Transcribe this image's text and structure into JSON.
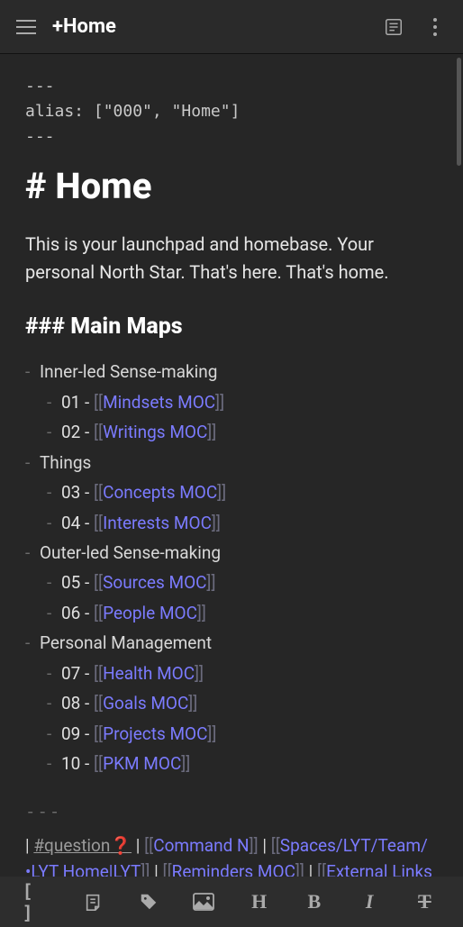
{
  "header": {
    "title": "+Home"
  },
  "frontmatter": {
    "open": "---",
    "line": "alias: [\"000\", \"Home\"]",
    "close": "---"
  },
  "h1": "# Home",
  "intro": "This is your launchpad and homebase. Your personal North Star. That's here. That's home.",
  "h3": "### Main Maps",
  "sections": [
    {
      "label": "Inner-led Sense-making",
      "items": [
        {
          "num": "01",
          "link": "Mindsets MOC"
        },
        {
          "num": "02",
          "link": "Writings MOC"
        }
      ]
    },
    {
      "label": "Things",
      "items": [
        {
          "num": "03",
          "link": "Concepts MOC"
        },
        {
          "num": "04",
          "link": "Interests MOC"
        }
      ]
    },
    {
      "label": "Outer-led Sense-making",
      "items": [
        {
          "num": "05",
          "link": "Sources MOC"
        },
        {
          "num": "06",
          "link": "People MOC"
        }
      ]
    },
    {
      "label": "Personal Management",
      "items": [
        {
          "num": "07",
          "link": "Health MOC"
        },
        {
          "num": "08",
          "link": "Goals MOC"
        },
        {
          "num": "09",
          "link": "Projects MOC"
        },
        {
          "num": "10",
          "link": "PKM MOC"
        }
      ]
    }
  ],
  "hr": "---",
  "footer": {
    "tag": "#question",
    "q": "❓",
    "link1": "Command N",
    "link2": "Spaces/LYT/Team/•LYT Home|LYT",
    "link3": "Reminders MOC",
    "link4": "External Links"
  },
  "tools": {
    "brackets": "[ ]",
    "heading": "H",
    "bold": "B",
    "italic": "I"
  }
}
